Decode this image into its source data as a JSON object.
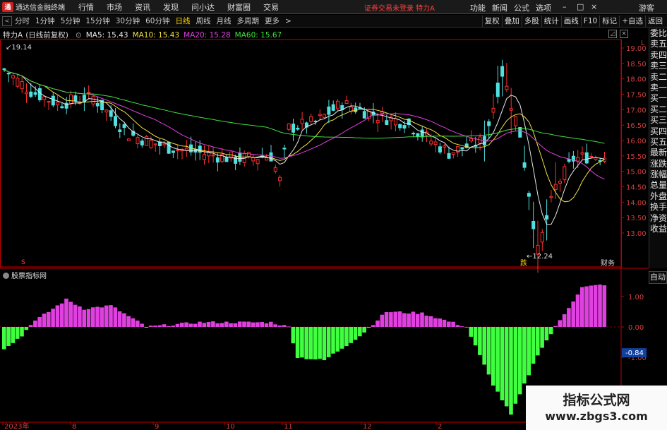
{
  "app": {
    "logo_char": "通",
    "title": "通达信金融终端",
    "menu": [
      "行情",
      "市场",
      "资讯",
      "发现",
      "问小达",
      "财富圈",
      "交易"
    ],
    "login_note": "证券交易未登录 特力A",
    "right_menu": [
      "功能",
      "新闻",
      "公式",
      "选项"
    ],
    "guest": "游客",
    "window_controls": [
      "–",
      "□",
      "×"
    ]
  },
  "period_bar": {
    "back": "<",
    "tabs": [
      "分时",
      "1分钟",
      "5分钟",
      "15分钟",
      "30分钟",
      "60分钟",
      "日线",
      "周线",
      "月线",
      "多周期",
      "更多"
    ],
    "active": "日线",
    "more_arrow": ">",
    "tools": [
      "复权",
      "叠加",
      "多股",
      "统计",
      "画线",
      "F10",
      "标记",
      "+自选",
      "返回"
    ]
  },
  "legend": {
    "stock": "特力A",
    "mode": "(日线前复权)",
    "items": [
      {
        "label": "MA5: 15.43",
        "color": "#e8e8e8"
      },
      {
        "label": "MA10: 15.43",
        "color": "#f0e040"
      },
      {
        "label": "MA20: 15.28",
        "color": "#e040e0"
      },
      {
        "label": "MA60: 15.67",
        "color": "#40e040"
      }
    ]
  },
  "side_panel": [
    "委比",
    "卖五",
    "卖四",
    "卖三",
    "卖二",
    "卖一",
    "买一",
    "买二",
    "买三",
    "买四",
    "买五",
    "最新",
    "涨跌",
    "涨幅",
    "总量",
    "外盘",
    "换手",
    "净资",
    "收益"
  ],
  "side_auto": "自动",
  "indicator_title": "股票指标网",
  "price_axis": {
    "ticks": [
      {
        "label": "19.00",
        "value": 19.0
      },
      {
        "label": "18.50",
        "value": 18.5
      },
      {
        "label": "18.00",
        "value": 18.0
      },
      {
        "label": "17.50",
        "value": 17.5
      },
      {
        "label": "17.00",
        "value": 17.0
      },
      {
        "label": "16.50",
        "value": 16.5
      },
      {
        "label": "16.00",
        "value": 16.0
      },
      {
        "label": "15.50",
        "value": 15.5
      },
      {
        "label": "15.00",
        "value": 15.0
      },
      {
        "label": "14.50",
        "value": 14.5
      },
      {
        "label": "14.00",
        "value": 14.0
      },
      {
        "label": "13.50",
        "value": 13.5
      },
      {
        "label": "13.00",
        "value": 13.0
      }
    ],
    "high_label": "19.14",
    "low_label": "12.24",
    "corner": "L"
  },
  "ind_axis": {
    "ticks": [
      {
        "label": "1.00",
        "value": 1.0
      },
      {
        "label": "0.00",
        "value": 0.0
      },
      {
        "label": "-1.00",
        "value": -1.0
      },
      {
        "label": "-2.00",
        "value": -2.0
      }
    ],
    "current_label": "-0.84",
    "current_value": -0.84
  },
  "markers": {
    "limit_down": "跌",
    "finance": "财务",
    "s_mark": "S"
  },
  "date_axis": [
    "2023年",
    "8",
    "9",
    "10",
    "11",
    "12",
    "2"
  ],
  "watermark": {
    "title": "指标公式网",
    "url": "www.zbgs3.com"
  },
  "colors": {
    "up": "#ff3030",
    "down": "#50e0e0",
    "pos_bar": "#e040e0",
    "neg_bar": "#40ff40",
    "ma5": "#e8e8e8",
    "ma10": "#f0e040",
    "ma20": "#e040e0",
    "ma60": "#40e040",
    "axis_red": "#c00000"
  }
}
